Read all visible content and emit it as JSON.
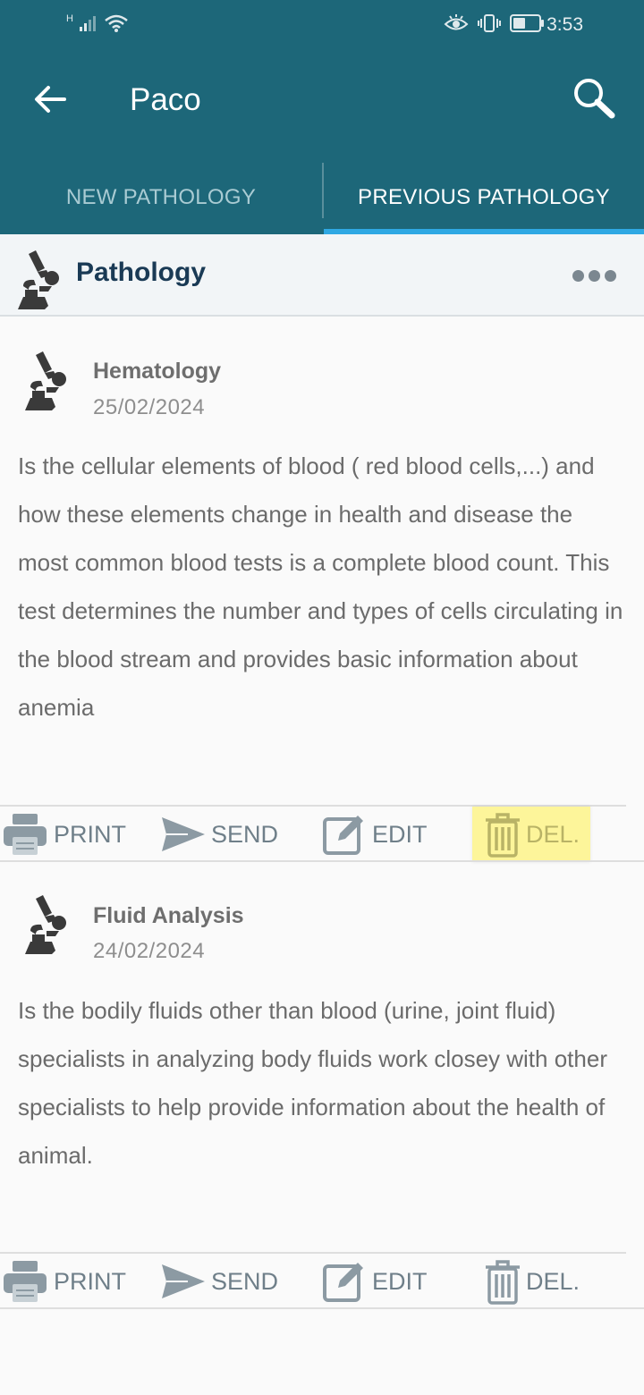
{
  "status_bar": {
    "time": "3:53",
    "network": "H",
    "icons": [
      "signal-icon",
      "wifi-icon",
      "eye-comfort-icon",
      "vibrate-icon",
      "battery-icon"
    ]
  },
  "toolbar": {
    "title": "Paco",
    "back_icon": "arrow-left-icon",
    "search_icon": "search-icon"
  },
  "tabs": [
    {
      "label": "NEW PATHOLOGY",
      "selected": false
    },
    {
      "label": "PREVIOUS PATHOLOGY",
      "selected": true
    }
  ],
  "section": {
    "title": "Pathology",
    "icon": "microscope-icon",
    "more_icon": "more-horizontal-icon"
  },
  "records": [
    {
      "title": "Hematology",
      "date": "25/02/2024",
      "body": "Is the cellular elements of blood ( red blood cells,...) and how these elements change in health and disease the most common blood tests is a complete blood count. This test determines the number and types of cells circulating in the blood stream and provides basic information about anemia",
      "actions": {
        "print": "PRINT",
        "send": "SEND",
        "edit": "EDIT",
        "delete": "DEL."
      }
    },
    {
      "title": "Fluid Analysis",
      "date": "24/02/2024",
      "body": "Is the bodily fluids other than blood (urine, joint fluid) specialists in analyzing body fluids work closey with other specialists to help provide information about the health of animal.",
      "actions": {
        "print": "PRINT",
        "send": "SEND",
        "edit": "EDIT",
        "delete": "DEL."
      }
    }
  ],
  "colors": {
    "appbar": "#1d6779",
    "tab_indicator": "#2fa8e3",
    "highlight": "#fdf59a",
    "action_gray": "#6f7f89"
  }
}
